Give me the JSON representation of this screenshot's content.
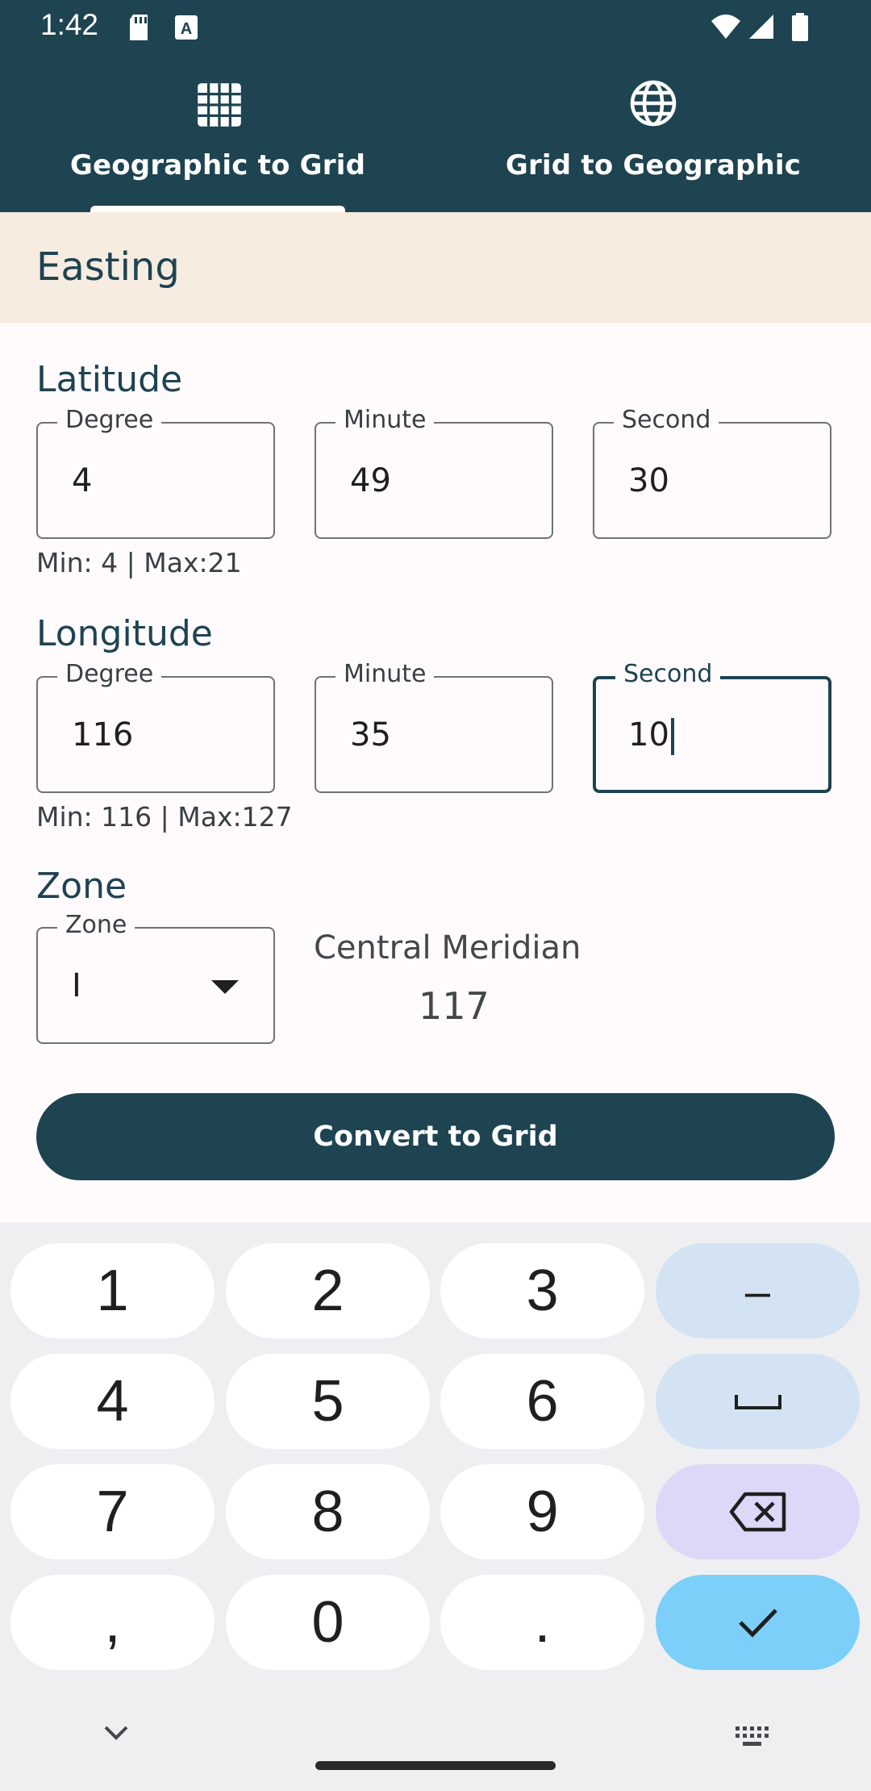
{
  "status_bar": {
    "time": "1:42"
  },
  "tabs": [
    {
      "label": "Geographic to Grid",
      "icon": "grid-icon",
      "selected": true
    },
    {
      "label": "Grid to Geographic",
      "icon": "globe-icon",
      "selected": false
    }
  ],
  "banner": {
    "title": "Easting"
  },
  "latitude": {
    "title": "Latitude",
    "degree": {
      "label": "Degree",
      "value": "4"
    },
    "minute": {
      "label": "Minute",
      "value": "49"
    },
    "second": {
      "label": "Second",
      "value": "30"
    },
    "hint": "Min: 4 | Max:21"
  },
  "longitude": {
    "title": "Longitude",
    "degree": {
      "label": "Degree",
      "value": "116"
    },
    "minute": {
      "label": "Minute",
      "value": "35"
    },
    "second": {
      "label": "Second",
      "value": "10"
    },
    "hint": "Min: 116 | Max:127"
  },
  "zone": {
    "title": "Zone",
    "select_label": "Zone",
    "select_value": "I",
    "central_meridian_label": "Central Meridian",
    "central_meridian_value": "117"
  },
  "convert_button": "Convert to Grid",
  "keyboard": {
    "keys": [
      "1",
      "2",
      "3",
      "–",
      "4",
      "5",
      "6",
      "␣",
      "7",
      "8",
      "9",
      "⌫",
      ",",
      "0",
      ".",
      "✓"
    ]
  },
  "colors": {
    "primary": "#1e4351",
    "banner": "#f6ece0",
    "keyboard_bg": "#efeff2"
  }
}
